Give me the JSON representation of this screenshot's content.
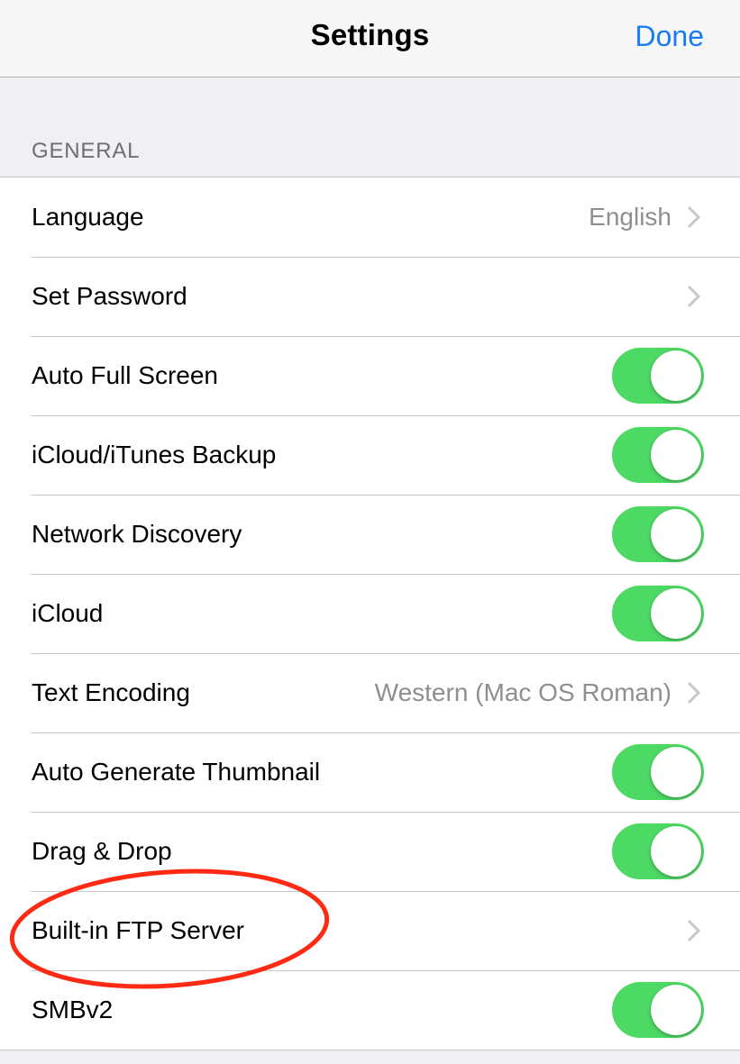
{
  "nav": {
    "title": "Settings",
    "done_label": "Done"
  },
  "general": {
    "header": "GENERAL",
    "rows": [
      {
        "label": "Language",
        "value": "English",
        "control": "chevron"
      },
      {
        "label": "Set Password",
        "control": "chevron"
      },
      {
        "label": "Auto Full Screen",
        "control": "toggle",
        "on": true
      },
      {
        "label": "iCloud/iTunes Backup",
        "control": "toggle",
        "on": true
      },
      {
        "label": "Network Discovery",
        "control": "toggle",
        "on": true
      },
      {
        "label": "iCloud",
        "control": "toggle",
        "on": true
      },
      {
        "label": "Text Encoding",
        "value": "Western (Mac OS Roman)",
        "control": "chevron"
      },
      {
        "label": "Auto Generate Thumbnail",
        "control": "toggle",
        "on": true
      },
      {
        "label": "Drag & Drop",
        "control": "toggle",
        "on": true
      },
      {
        "label": "Built-in FTP Server",
        "control": "chevron",
        "highlighted": true
      },
      {
        "label": "SMBv2",
        "control": "toggle",
        "on": true
      }
    ]
  },
  "colors": {
    "accent": "#1a7cf5",
    "toggle_on": "#4cd964",
    "annotation": "#ff2a14",
    "secondary_text": "#8e8e93",
    "background": "#efeff4"
  }
}
